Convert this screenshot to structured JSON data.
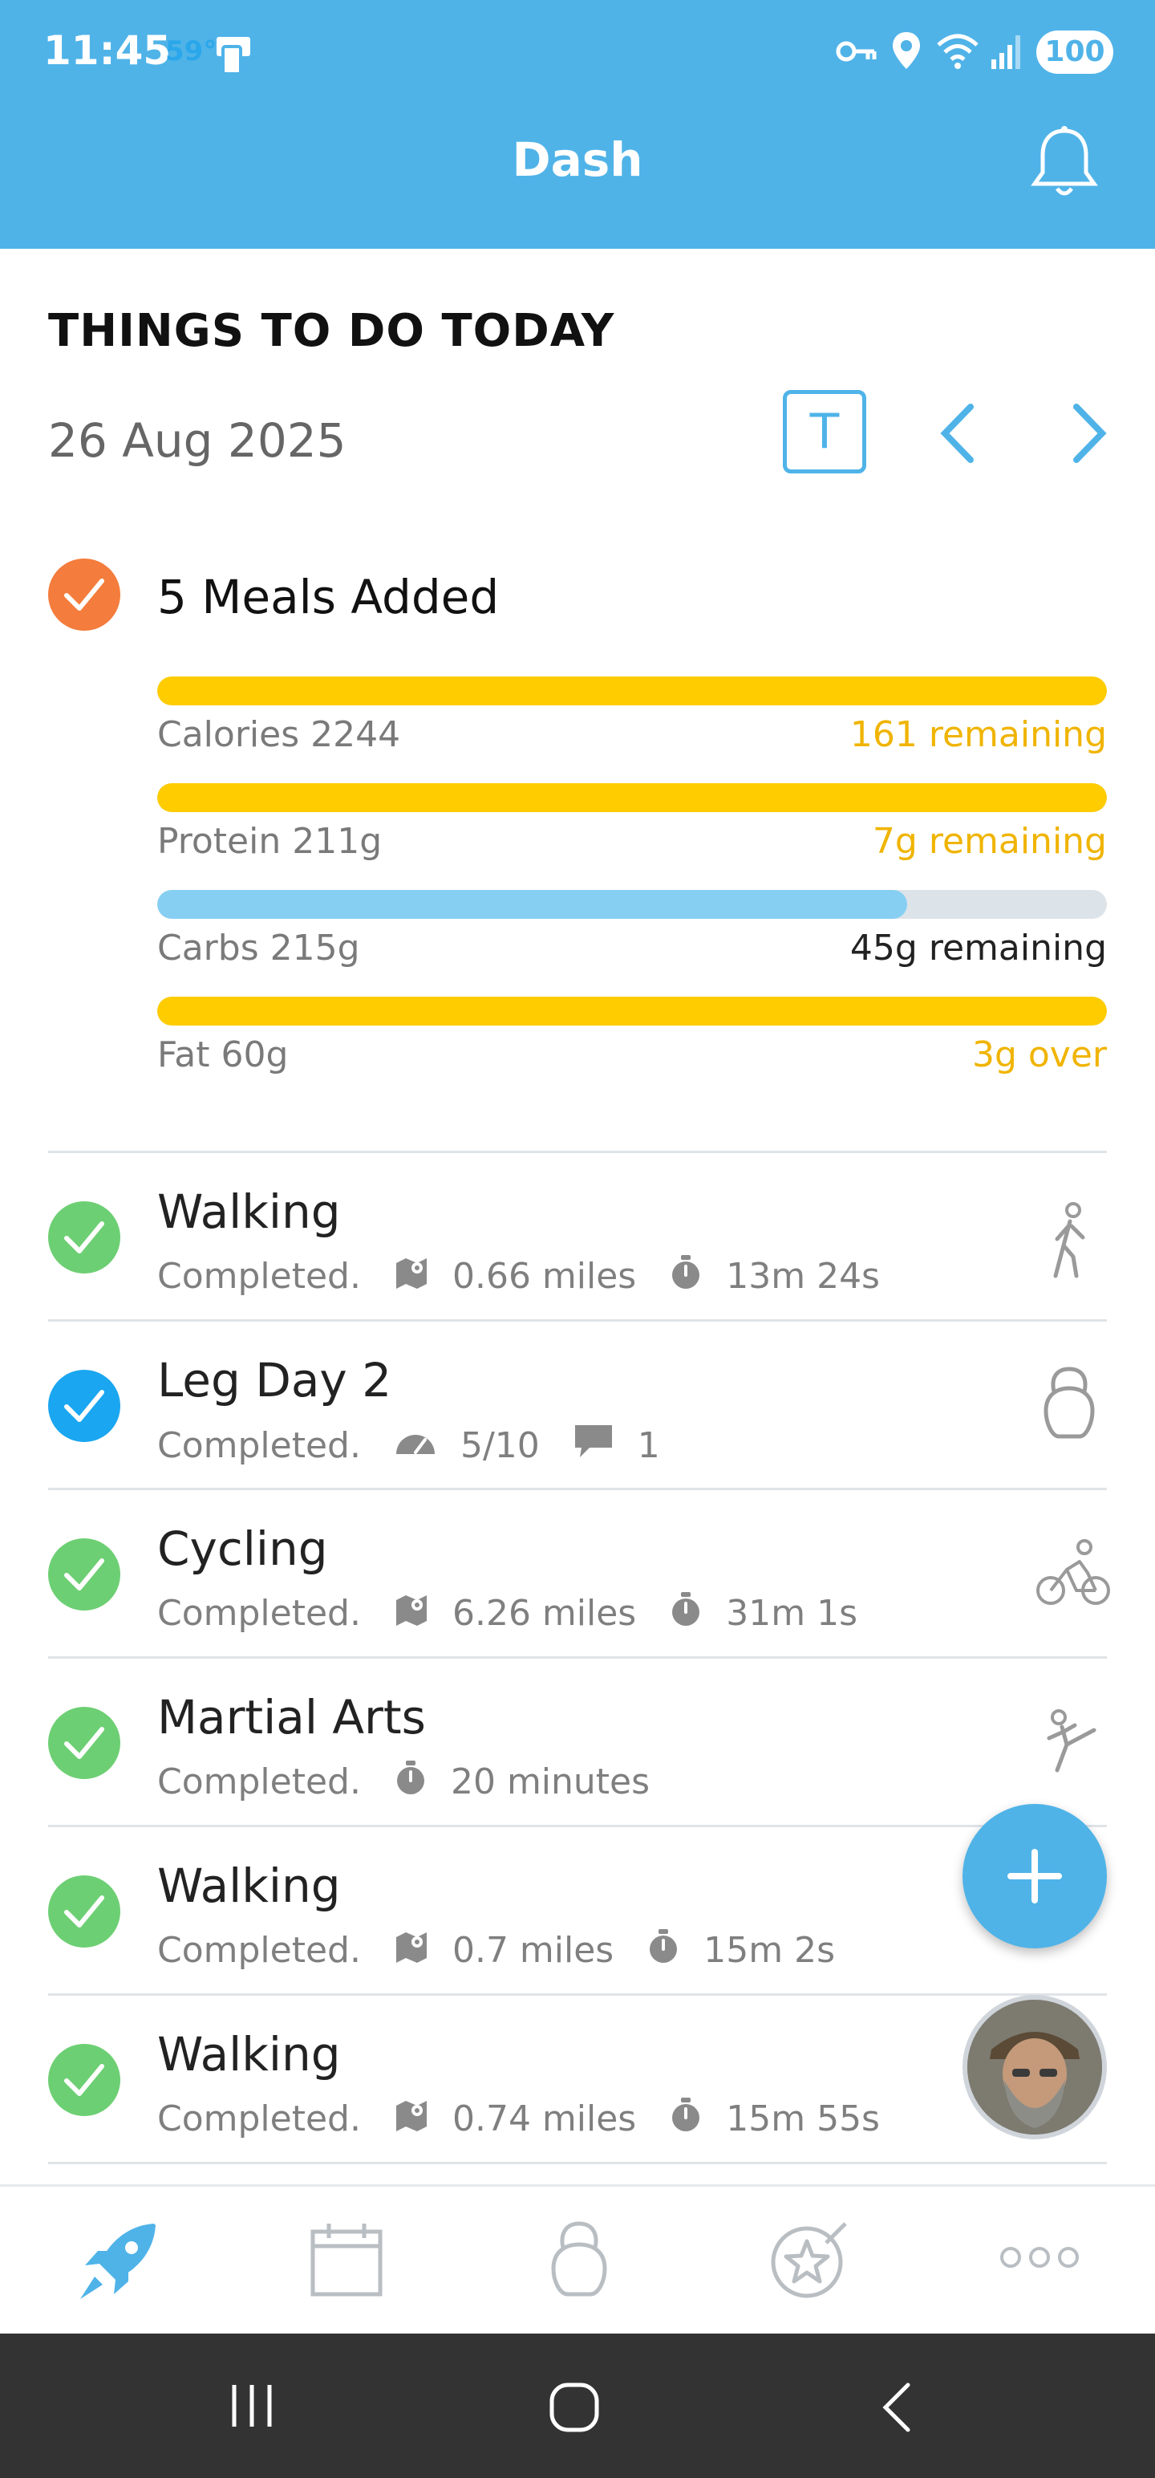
{
  "status_bar": {
    "time": "11:45",
    "temperature": "59°",
    "battery": "100"
  },
  "header": {
    "title": "Dash"
  },
  "section": {
    "title": "THINGS TO DO TODAY",
    "date": "26 Aug 2025",
    "today_button": "T"
  },
  "meals": {
    "title": "5 Meals Added",
    "nutrients": [
      {
        "label": "Calories 2244",
        "remaining": "161 remaining",
        "progress": 1.0,
        "color": "#ffcc00",
        "remaining_color": "#f0b400"
      },
      {
        "label": "Protein 211g",
        "remaining": "7g remaining",
        "progress": 1.0,
        "color": "#ffcc00",
        "remaining_color": "#f0b400"
      },
      {
        "label": "Carbs 215g",
        "remaining": "45g remaining",
        "progress": 0.79,
        "color": "#86cff2",
        "remaining_color": "#222222"
      },
      {
        "label": "Fat 60g",
        "remaining": "3g over",
        "progress": 1.0,
        "color": "#ffcc00",
        "remaining_color": "#f0b400"
      }
    ]
  },
  "activities": [
    {
      "name": "Walking",
      "status": "Completed.",
      "distance": "0.66 miles",
      "duration": "13m 24s",
      "check_color": "#6dcf73",
      "icon": "walking-icon"
    },
    {
      "name": "Leg Day 2",
      "status": "Completed.",
      "effort": "5/10",
      "comments": "1",
      "check_color": "#1aa6f0",
      "icon": "kettlebell-icon"
    },
    {
      "name": "Cycling",
      "status": "Completed.",
      "distance": "6.26 miles",
      "duration": "31m 1s",
      "check_color": "#6dcf73",
      "icon": "cycling-icon"
    },
    {
      "name": "Martial Arts",
      "status": "Completed.",
      "duration": "20 minutes",
      "check_color": "#6dcf73",
      "icon": "martial-arts-icon"
    },
    {
      "name": "Walking",
      "status": "Completed.",
      "distance": "0.7 miles",
      "duration": "15m 2s",
      "check_color": "#6dcf73",
      "icon": "walking-icon"
    },
    {
      "name": "Walking",
      "status": "Completed.",
      "distance": "0.74 miles",
      "duration": "15m 55s",
      "check_color": "#6dcf73",
      "icon": "walking-icon"
    }
  ],
  "colors": {
    "accent": "#4fb3e8",
    "meal_check": "#f47c3c",
    "tab_active": "#4fb3e8",
    "tab_inactive": "#b9bec3"
  }
}
